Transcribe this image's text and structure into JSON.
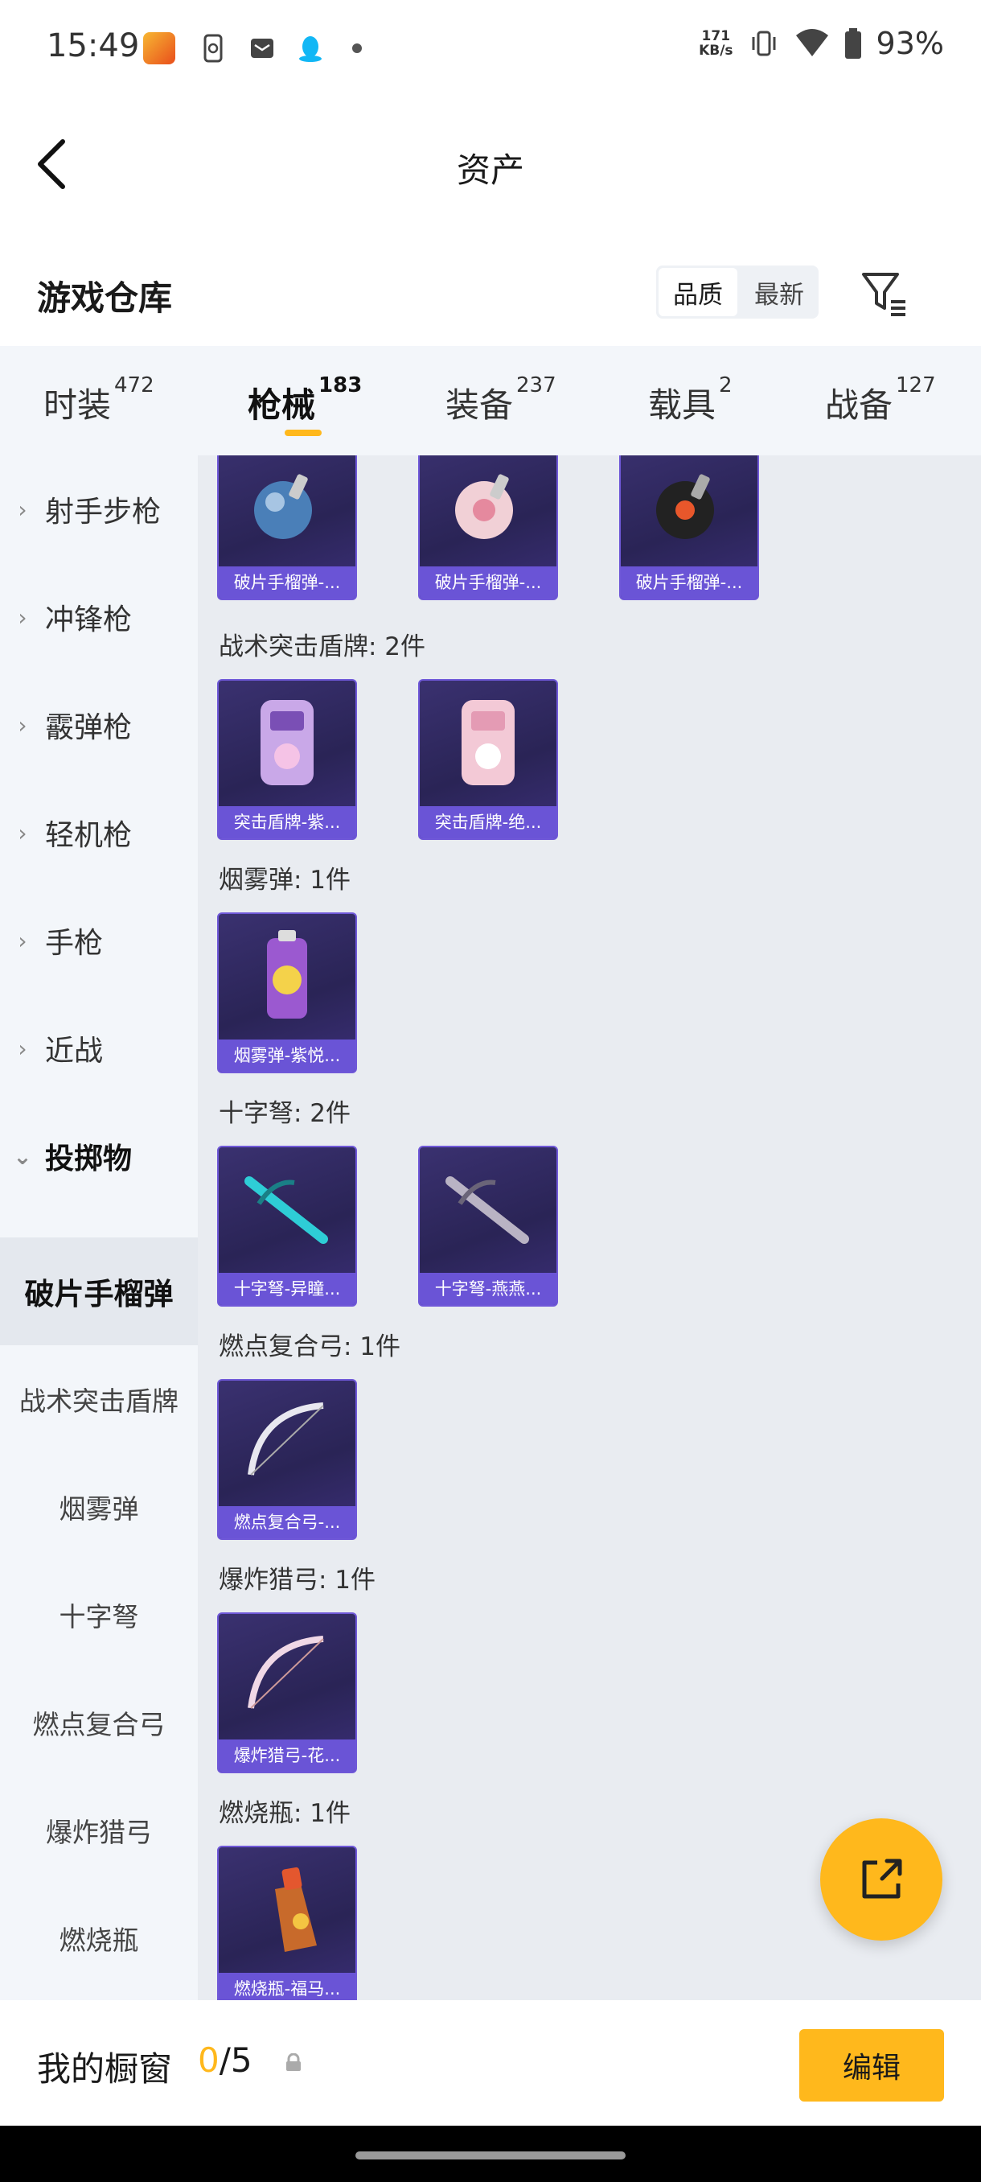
{
  "status_bar": {
    "time": "15:49",
    "speed_value": "171",
    "speed_unit": "KB/s",
    "battery": "93%"
  },
  "header": {
    "title": "资产"
  },
  "section": {
    "title": "游戏仓库",
    "sort_options": [
      "品质",
      "最新"
    ],
    "sort_selected": "品质"
  },
  "tabs": [
    {
      "label": "时装",
      "count": "472"
    },
    {
      "label": "枪械",
      "count": "183",
      "active": true
    },
    {
      "label": "装备",
      "count": "237"
    },
    {
      "label": "载具",
      "count": "2"
    },
    {
      "label": "战备",
      "count": "127"
    }
  ],
  "sidebar": {
    "categories": [
      "射手步枪",
      "冲锋枪",
      "霰弹枪",
      "轻机枪",
      "手枪",
      "近战",
      "投掷物"
    ],
    "subcategories": [
      "破片手榴弹",
      "战术突击盾牌",
      "烟雾弹",
      "十字弩",
      "燃点复合弓",
      "爆炸猎弓",
      "燃烧瓶"
    ],
    "active_subcategory": "破片手榴弹"
  },
  "groups": [
    {
      "title": "",
      "items": [
        "破片手榴弹-...",
        "破片手榴弹-...",
        "破片手榴弹-..."
      ]
    },
    {
      "title": "战术突击盾牌: 2件",
      "items": [
        "突击盾牌-紫...",
        "突击盾牌-绝..."
      ]
    },
    {
      "title": "烟雾弹: 1件",
      "items": [
        "烟雾弹-紫悦..."
      ]
    },
    {
      "title": "十字弩: 2件",
      "items": [
        "十字弩-异瞳...",
        "十字弩-燕燕..."
      ]
    },
    {
      "title": "燃点复合弓: 1件",
      "items": [
        "燃点复合弓-..."
      ]
    },
    {
      "title": "爆炸猎弓: 1件",
      "items": [
        "爆炸猎弓-花..."
      ]
    },
    {
      "title": "燃烧瓶: 1件",
      "items": [
        "燃烧瓶-福马..."
      ]
    }
  ],
  "bottom_bar": {
    "title": "我的橱窗",
    "current": "0",
    "separator": "/",
    "total": "5",
    "edit_label": "编辑"
  },
  "colors": {
    "accent": "#ffb81c",
    "card_label": "#6a54d6",
    "card_bg": "#2a2456"
  }
}
